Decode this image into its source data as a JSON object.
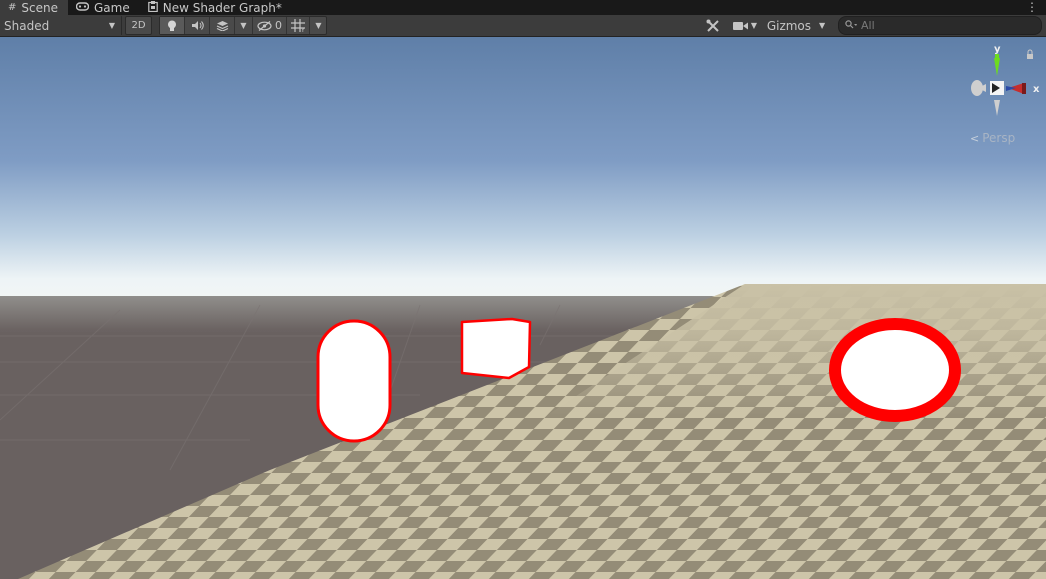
{
  "tabs": [
    {
      "icon": "scene-grid-icon",
      "label": "Scene",
      "active": true
    },
    {
      "icon": "gamepad-icon",
      "label": "Game",
      "active": false
    },
    {
      "icon": "shader-graph-icon",
      "label": "New Shader Graph*",
      "active": false
    }
  ],
  "tab_menu_label": "⋮",
  "toolbar": {
    "draw_mode": "Shaded",
    "toggle_2d": "2D",
    "hidden_count": "0",
    "gizmos_label": "Gizmos",
    "search_placeholder": "All"
  },
  "scene_gizmo": {
    "y_label": "y",
    "x_label": "x",
    "projection_label": "Persp"
  },
  "colors": {
    "accent_red": "#ff0000",
    "axis_y": "#6ddc1e",
    "axis_x": "#c62d2d",
    "ground": "#cdc5a9"
  }
}
